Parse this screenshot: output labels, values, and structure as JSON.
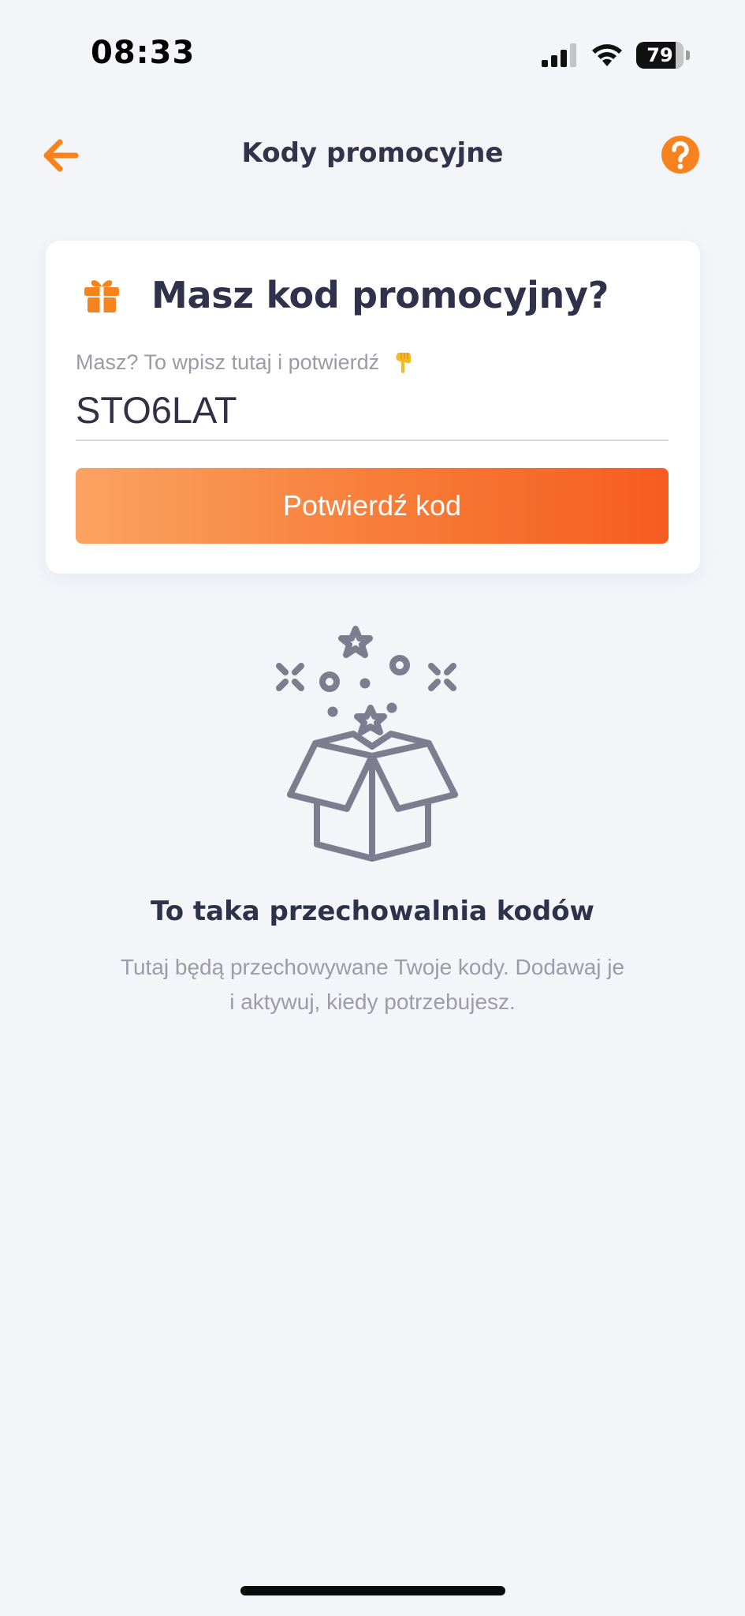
{
  "status_bar": {
    "time": "08:33",
    "battery": "79"
  },
  "header": {
    "title": "Kody promocyjne",
    "back_icon": "arrow-left-icon",
    "help_icon": "question-circle-icon"
  },
  "promo_card": {
    "title": "Masz kod promocyjny?",
    "icon": "gift-icon",
    "field_label": "Masz? To wpisz tutaj i potwierdź",
    "code_value": "STO6LAT",
    "confirm_label": "Potwierdź kod"
  },
  "empty_state": {
    "title": "To taka przechowalnia kodów",
    "description": "Tutaj będą przechowywane Twoje kody. Dodawaj je i aktywuj, kiedy potrzebujesz."
  },
  "colors": {
    "accent": "#f7831f",
    "background": "#f3f5f9",
    "button_start": "#fba362",
    "button_end": "#f65c20"
  }
}
